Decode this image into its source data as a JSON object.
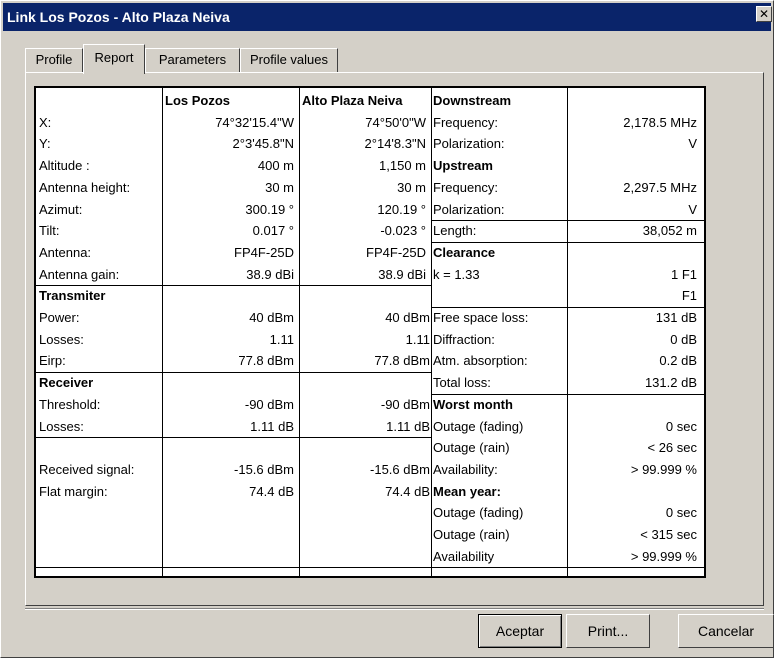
{
  "window": {
    "title": "Link Los Pozos - Alto Plaza Neiva",
    "close_glyph": "✕"
  },
  "tabs": [
    "Profile",
    "Report",
    "Parameters",
    "Profile values"
  ],
  "active_tab": "Report",
  "sites": {
    "header_a": "Los Pozos",
    "header_b": "Alto Plaza Neiva",
    "rows": [
      {
        "label": "X:",
        "a": "74°32'15.4\"W",
        "b": "74°50'0\"W"
      },
      {
        "label": "Y:",
        "a": "2°3'45.8\"N",
        "b": "2°14'8.3\"N"
      },
      {
        "label": "Altitude :",
        "a": "400  m",
        "b": "1,150  m"
      },
      {
        "label": "Antenna height:",
        "a": "30  m",
        "b": "30  m"
      },
      {
        "label": "Azimut:",
        "a": "300.19  °",
        "b": "120.19  °"
      },
      {
        "label": "Tilt:",
        "a": "0.017  °",
        "b": "-0.023  °"
      },
      {
        "label": "Antenna:",
        "a": "FP4F-25D",
        "b": "FP4F-25D"
      },
      {
        "label": "Antenna gain:",
        "a": "38.9  dBi",
        "b": "38.9  dBi"
      }
    ],
    "transmitter": {
      "header": "Transmiter",
      "rows": [
        {
          "label": "Power:",
          "a": "40  dBm",
          "b": "40  dBm"
        },
        {
          "label": "Losses:",
          "a": "1.11",
          "b": "1.11"
        },
        {
          "label": "Eirp:",
          "a": "77.8  dBm",
          "b": "77.8  dBm"
        }
      ]
    },
    "receiver": {
      "header": "Receiver",
      "rows": [
        {
          "label": "Threshold:",
          "a": "-90  dBm",
          "b": "-90  dBm"
        },
        {
          "label": "Losses:",
          "a": "1.11  dB",
          "b": "1.11  dB"
        }
      ]
    },
    "signal_rows": [
      {
        "label": "Received signal:",
        "a": "-15.6  dBm",
        "b": "-15.6  dBm"
      },
      {
        "label": "Flat margin:",
        "a": "74.4  dB",
        "b": "74.4  dB"
      }
    ]
  },
  "link": {
    "downstream_header": "Downstream",
    "downstream": [
      {
        "label": "Frequency:",
        "value": "2,178.5  MHz"
      },
      {
        "label": "Polarization:",
        "value": "V"
      }
    ],
    "upstream_header": "Upstream",
    "upstream": [
      {
        "label": "Frequency:",
        "value": "2,297.5  MHz"
      },
      {
        "label": "Polarization:",
        "value": "V"
      }
    ],
    "length": {
      "label": "Length:",
      "value": "38,052  m"
    },
    "clearance_header": "Clearance",
    "clearance_k": {
      "label": "k = 1.33",
      "value": "1  F1"
    },
    "clearance_extra": "F1",
    "losses": [
      {
        "label": "Free space loss:",
        "value": "131  dB"
      },
      {
        "label": "Diffraction:",
        "value": "0  dB"
      },
      {
        "label": "Atm. absorption:",
        "value": "0.2  dB"
      },
      {
        "label": "Total loss:",
        "value": "131.2  dB"
      }
    ],
    "worst_header": "Worst month",
    "worst": [
      {
        "label": "Outage (fading)",
        "value": "0  sec"
      },
      {
        "label": "Outage (rain)",
        "value": "< 26  sec"
      },
      {
        "label": "Availability:",
        "value": "> 99.999  %"
      }
    ],
    "mean_header": "Mean year:",
    "mean": [
      {
        "label": "Outage (fading)",
        "value": "0  sec"
      },
      {
        "label": "Outage (rain)",
        "value": "< 315  sec"
      },
      {
        "label": "Availability",
        "value": "> 99.999  %"
      }
    ]
  },
  "buttons": {
    "accept": "Aceptar",
    "print": "Print...",
    "cancel": "Cancelar"
  }
}
